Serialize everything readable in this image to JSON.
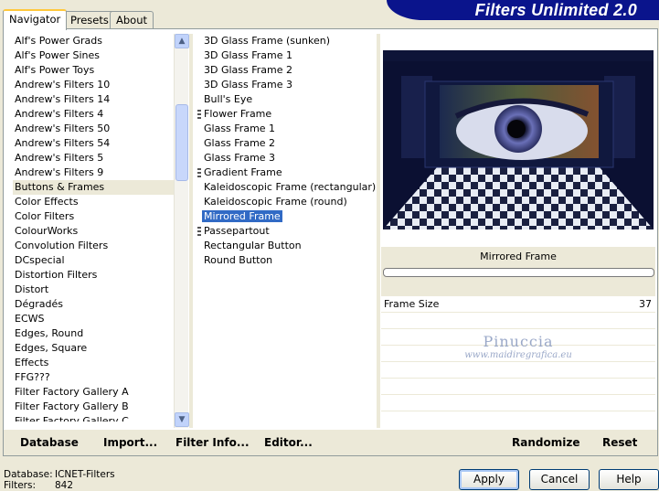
{
  "app": {
    "title": "Filters Unlimited 2.0"
  },
  "tabs": [
    {
      "label": "Navigator",
      "active": true
    },
    {
      "label": "Presets",
      "active": false
    },
    {
      "label": "About",
      "active": false
    }
  ],
  "categories": [
    "Alf's Power Grads",
    "Alf's Power Sines",
    "Alf's Power Toys",
    "Andrew's Filters 10",
    "Andrew's Filters 14",
    "Andrew's Filters 4",
    "Andrew's Filters 50",
    "Andrew's Filters 54",
    "Andrew's Filters 5",
    "Andrew's Filters 9",
    "Buttons & Frames",
    "Color Effects",
    "Color Filters",
    "ColourWorks",
    "Convolution Filters",
    "DCspecial",
    "Distortion Filters",
    "Distort",
    "Dégradés",
    "ECWS",
    "Edges, Round",
    "Edges, Square",
    "Effects",
    "FFG???",
    "Filter Factory Gallery A",
    "Filter Factory Gallery B",
    "Filter Factory Gallery C"
  ],
  "selected_category": "Buttons & Frames",
  "filters": [
    {
      "label": "3D Glass Frame (sunken)",
      "marker": false
    },
    {
      "label": "3D Glass Frame 1",
      "marker": false
    },
    {
      "label": "3D Glass Frame 2",
      "marker": false
    },
    {
      "label": "3D Glass Frame 3",
      "marker": false
    },
    {
      "label": "Bull's Eye",
      "marker": false
    },
    {
      "label": "Flower Frame",
      "marker": true
    },
    {
      "label": "Glass Frame 1",
      "marker": false
    },
    {
      "label": "Glass Frame 2",
      "marker": false
    },
    {
      "label": "Glass Frame 3",
      "marker": false
    },
    {
      "label": "Gradient Frame",
      "marker": true
    },
    {
      "label": "Kaleidoscopic Frame (rectangular)",
      "marker": false
    },
    {
      "label": "Kaleidoscopic Frame (round)",
      "marker": false
    },
    {
      "label": "Mirrored Frame",
      "marker": false,
      "selected": true
    },
    {
      "label": "Passepartout",
      "marker": true
    },
    {
      "label": "Rectangular Button",
      "marker": false
    },
    {
      "label": "Round Button",
      "marker": false
    }
  ],
  "preview": {
    "filter_name": "Mirrored Frame"
  },
  "parameters": [
    {
      "label": "Frame Size",
      "value": "37"
    }
  ],
  "watermark": {
    "line1": "Pinuccia",
    "line2": "www.maidiregrafica.eu"
  },
  "toolbar": {
    "database": "Database",
    "import": "Import...",
    "filter_info": "Filter Info...",
    "editor": "Editor...",
    "randomize": "Randomize",
    "reset": "Reset"
  },
  "status": {
    "database_label": "Database:",
    "database_value": "ICNET-Filters",
    "filters_label": "Filters:",
    "filters_value": "842"
  },
  "buttons": {
    "apply": "Apply",
    "cancel": "Cancel",
    "help": "Help"
  },
  "colors": {
    "banner": "#0a148c",
    "selection": "#316ac5",
    "tab_accent": "#ffc83c"
  }
}
